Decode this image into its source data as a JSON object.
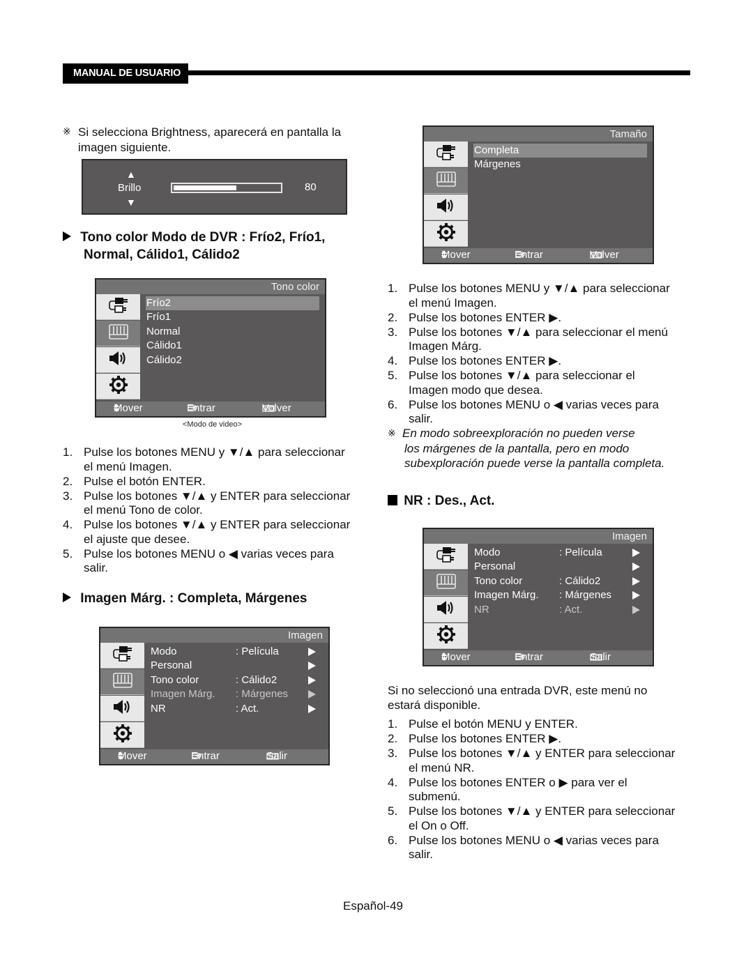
{
  "header": {
    "tag": "MANUAL DE USUARIO"
  },
  "left": {
    "brightness_note": {
      "mark": "※",
      "line1": "Si selecciona Brightness, aparecerá en pantalla la",
      "line2": "imagen siguiente."
    },
    "brightness_osd": {
      "label": "Brillo",
      "up": "▲",
      "down": "▼",
      "value": "80",
      "bar_fill_fraction": 0.58
    },
    "tono_heading": {
      "line1": "Tono color Modo de DVR : Frío2, Frío1,",
      "line2": "Normal, Cálido1, Cálido2"
    },
    "tono_osd": {
      "title": "Tono color",
      "options": [
        "Frío2",
        "Frío1",
        "Normal",
        "Cálido1",
        "Cálido2"
      ],
      "selected_index": 0,
      "footer": {
        "move": "Mover",
        "enter": "Entrar",
        "back": "Volver"
      },
      "caption": "<Modo de video>"
    },
    "tono_steps": [
      {
        "num": "1.",
        "line1": "Pulse los botones MENU y ▼/▲ para seleccionar",
        "line2": "el menú Imagen."
      },
      {
        "num": "2.",
        "line1": "Pulse el botón ENTER.",
        "line2": ""
      },
      {
        "num": "3.",
        "line1": "Pulse los botones ▼/▲ y ENTER para seleccionar",
        "line2": "el menú Tono de color."
      },
      {
        "num": "4.",
        "line1": "Pulse los botones ▼/▲ y ENTER para seleccionar",
        "line2": "el ajuste que desee."
      },
      {
        "num": "5.",
        "line1": "Pulse los botones MENU o ◀ varias veces para",
        "line2": "salir."
      }
    ],
    "marg_heading": "Imagen Márg. : Completa, Márgenes",
    "imagen_osd": {
      "title": "Imagen",
      "rows": [
        {
          "key": "Modo",
          "value": ": Película",
          "dim": false
        },
        {
          "key": "Personal",
          "value": "",
          "dim": false
        },
        {
          "key": "Tono color",
          "value": ": Cálido2",
          "dim": false
        },
        {
          "key": "Imagen Márg.",
          "value": ": Márgenes",
          "dim": true
        },
        {
          "key": "NR",
          "value": ": Act.",
          "dim": false
        }
      ],
      "footer": {
        "move": "Mover",
        "enter": "Entrar",
        "back": "Salir"
      }
    }
  },
  "right": {
    "tamano_osd": {
      "title": "Tamaño",
      "options": [
        "Completa",
        "Márgenes"
      ],
      "selected_index": 0,
      "footer": {
        "move": "Mover",
        "enter": "Entrar",
        "back": "Volver"
      }
    },
    "marg_steps": [
      {
        "num": "1.",
        "line1": "Pulse los botones MENU y ▼/▲ para seleccionar",
        "line2": "el menú Imagen."
      },
      {
        "num": "2.",
        "line1": "Pulse los botones ENTER ▶.",
        "line2": ""
      },
      {
        "num": "3.",
        "line1": "Pulse los botones ▼/▲ para seleccionar el menú",
        "line2": "Imagen Márg."
      },
      {
        "num": "4.",
        "line1": "Pulse los botones ENTER ▶.",
        "line2": ""
      },
      {
        "num": "5.",
        "line1": "Pulse los botones ▼/▲ para seleccionar el",
        "line2": "Imagen modo que desea."
      },
      {
        "num": "6.",
        "line1": "Pulse los botones MENU o ◀ varias veces para",
        "line2": "salir."
      }
    ],
    "marg_note": {
      "mark": "※",
      "line1": "En modo sobreexploración no pueden verse",
      "line2": "los márgenes de la pantalla, pero en modo",
      "line3": "subexploración puede verse la pantalla completa."
    },
    "nr_heading": "NR : Des., Act.",
    "nr_osd": {
      "title": "Imagen",
      "rows": [
        {
          "key": "Modo",
          "value": ": Película",
          "dim": false
        },
        {
          "key": "Personal",
          "value": "",
          "dim": false
        },
        {
          "key": "Tono color",
          "value": ": Cálido2",
          "dim": false
        },
        {
          "key": "Imagen Márg.",
          "value": ": Márgenes",
          "dim": false
        },
        {
          "key": "NR",
          "value": ": Act.",
          "dim": true
        }
      ],
      "footer": {
        "move": "Mover",
        "enter": "Entrar",
        "back": "Salir"
      }
    },
    "nr_intro": {
      "line1": "Si no seleccionó una entrada DVR, este menú no",
      "line2": "estará disponible."
    },
    "nr_steps": [
      {
        "num": "1.",
        "line1": "Pulse el botón MENU y ENTER.",
        "line2": ""
      },
      {
        "num": "2.",
        "line1": "Pulse los botones ENTER ▶.",
        "line2": ""
      },
      {
        "num": "3.",
        "line1": "Pulse los botones ▼/▲ y ENTER para seleccionar",
        "line2": "el menú NR."
      },
      {
        "num": "4.",
        "line1": "Pulse los botones ENTER o ▶ para ver el",
        "line2": "submenú."
      },
      {
        "num": "5.",
        "line1": "Pulse los botones ▼/▲ y ENTER para seleccionar",
        "line2": "el On o Off."
      },
      {
        "num": "6.",
        "line1": "Pulse los botones MENU o ◀ varias veces para",
        "line2": "salir."
      }
    ]
  },
  "page_footer": "Español-49",
  "icons": {
    "side": [
      "input-plug-icon",
      "picture-icon",
      "speaker-icon",
      "gear-icon"
    ],
    "footer": [
      "updown-arrows-icon",
      "enter-icon",
      "menu-icon"
    ]
  }
}
